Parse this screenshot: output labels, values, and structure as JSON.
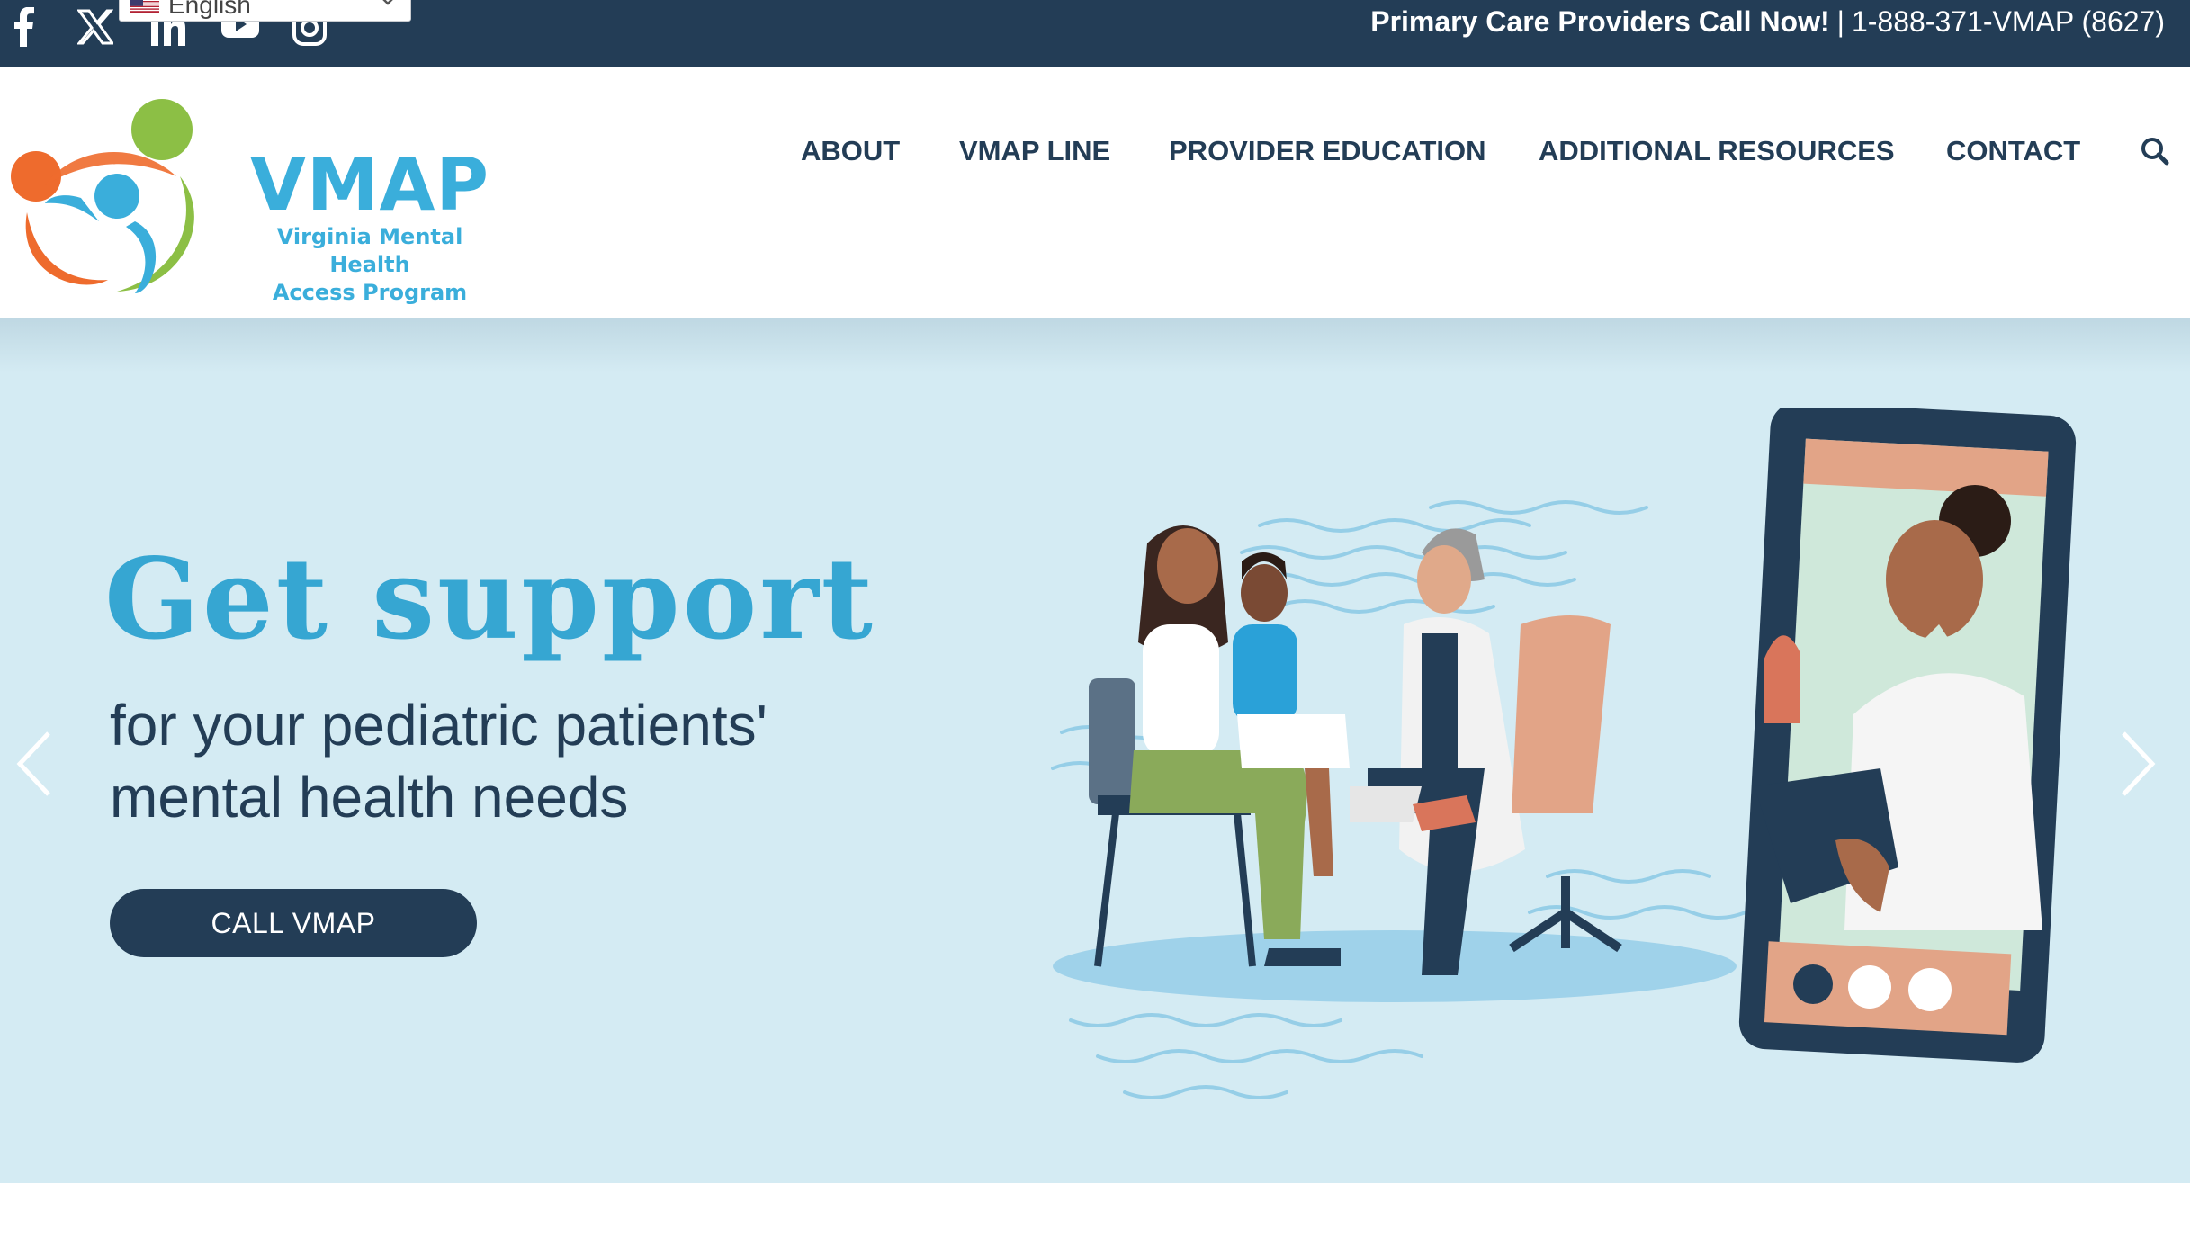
{
  "topbar": {
    "social_icons": [
      "facebook-icon",
      "x-icon",
      "linkedin-icon",
      "youtube-icon",
      "instagram-icon"
    ],
    "language": "English",
    "callout_bold": "Primary Care Providers Call Now!",
    "callout_separator": "|",
    "callout_phone": "1-888-371-VMAP (8627)"
  },
  "logo": {
    "title": "VMAP",
    "subtitle_line1": "Virginia Mental Health",
    "subtitle_line2": "Access Program"
  },
  "nav": {
    "items": [
      {
        "label": "ABOUT"
      },
      {
        "label": "VMAP LINE"
      },
      {
        "label": "PROVIDER EDUCATION"
      },
      {
        "label": "ADDITIONAL RESOURCES"
      },
      {
        "label": "CONTACT"
      }
    ],
    "search_icon": "search-icon"
  },
  "hero": {
    "headline": "Get support",
    "subline_1": "for your pediatric patients'",
    "subline_2": "mental health needs",
    "cta_label": "CALL VMAP",
    "prev_icon": "chevron-left-icon",
    "next_icon": "chevron-right-icon"
  },
  "colors": {
    "navy": "#233d56",
    "brand_blue": "#36a6d2",
    "hero_bg": "#d4ebf3",
    "logo_orange": "#ee6b2d",
    "logo_green": "#8cbf45",
    "logo_blue": "#3aaedb"
  }
}
